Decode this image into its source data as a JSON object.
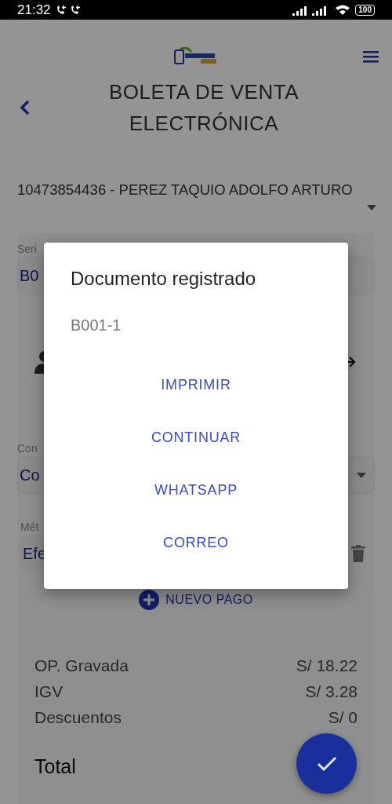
{
  "status_bar": {
    "time": "21:32",
    "battery": "100"
  },
  "header": {
    "title": "BOLETA DE VENTA ELECTRÓNICA"
  },
  "customer": {
    "value": "10473854436 - PEREZ TAQUIO ADOLFO ARTURO"
  },
  "form": {
    "serie": {
      "label": "Seri",
      "value": "B0"
    },
    "condition": {
      "label": "Con",
      "value": "Co"
    },
    "payments": [
      {
        "label": "Mét",
        "value": "Efe"
      }
    ],
    "new_payment": "NUEVO PAGO"
  },
  "totals": [
    {
      "label": "OP. Gravada",
      "value": "S/ 18.22"
    },
    {
      "label": "IGV",
      "value": "S/ 3.28"
    },
    {
      "label": "Descuentos",
      "value": "S/ 0"
    }
  ],
  "total": {
    "label": "Total"
  },
  "dialog": {
    "title": "Documento registrado",
    "subtitle": "B001-1",
    "actions": [
      "IMPRIMIR",
      "CONTINUAR",
      "WHATSAPP",
      "CORREO"
    ]
  }
}
